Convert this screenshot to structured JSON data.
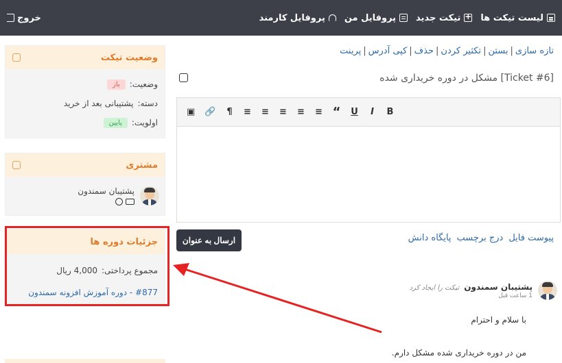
{
  "nav": {
    "items": [
      {
        "label": "لیست تیکت ها",
        "icon": "list-icon"
      },
      {
        "label": "تیکت جدید",
        "icon": "plus-icon"
      },
      {
        "label": "پروفایل من",
        "icon": "profile-card-icon"
      },
      {
        "label": "پروفایل کارمند",
        "icon": "headset-icon"
      }
    ],
    "logout": "خروج"
  },
  "ticket_status": {
    "title": "وضعیت تیکت",
    "status_label": "وضعیت:",
    "status_value": "باز",
    "category_label": "دسته:",
    "category_value": "پشتیبانی بعد از خرید",
    "priority_label": "اولویت:",
    "priority_value": "پایین"
  },
  "customer": {
    "title": "مشتری",
    "name": "پشتیبان سمندون"
  },
  "course_details": {
    "title": "جزئیات دوره ها",
    "total_label": "مجموع پرداختی:",
    "total_value": "4,000 ریال",
    "course_link": "#877 - دوره آموزش افزونه سمندون"
  },
  "actions": [
    "تازه سازی",
    "بستن",
    "تکثیر کردن",
    "حذف",
    "کپی آدرس",
    "پرینت"
  ],
  "ticket": {
    "title": "[Ticket #6] مشکل در دوره خریداری شده"
  },
  "editor": {
    "toolbar": [
      "B",
      "I",
      "U",
      "“",
      "≡",
      "≡",
      "≡",
      "≡",
      "≡",
      "¶",
      "🔗",
      "▣"
    ]
  },
  "attach": [
    "پیوست فایل",
    "درج برچسب",
    "پایگاه دانش"
  ],
  "send_button": "ارسال به عنوان",
  "message": {
    "author": "پشتیبان سمندون",
    "action": "تیکت را ایجاد کرد",
    "time": "1 ساعت قبل",
    "lines": [
      "با سلام و احترام",
      "من در دوره خریداری شده مشکل دارم."
    ]
  },
  "colors": {
    "topbar": "#3d4049",
    "accent": "#e07b2a",
    "highlight_box": "#e52323",
    "link": "#2e6aa8"
  }
}
